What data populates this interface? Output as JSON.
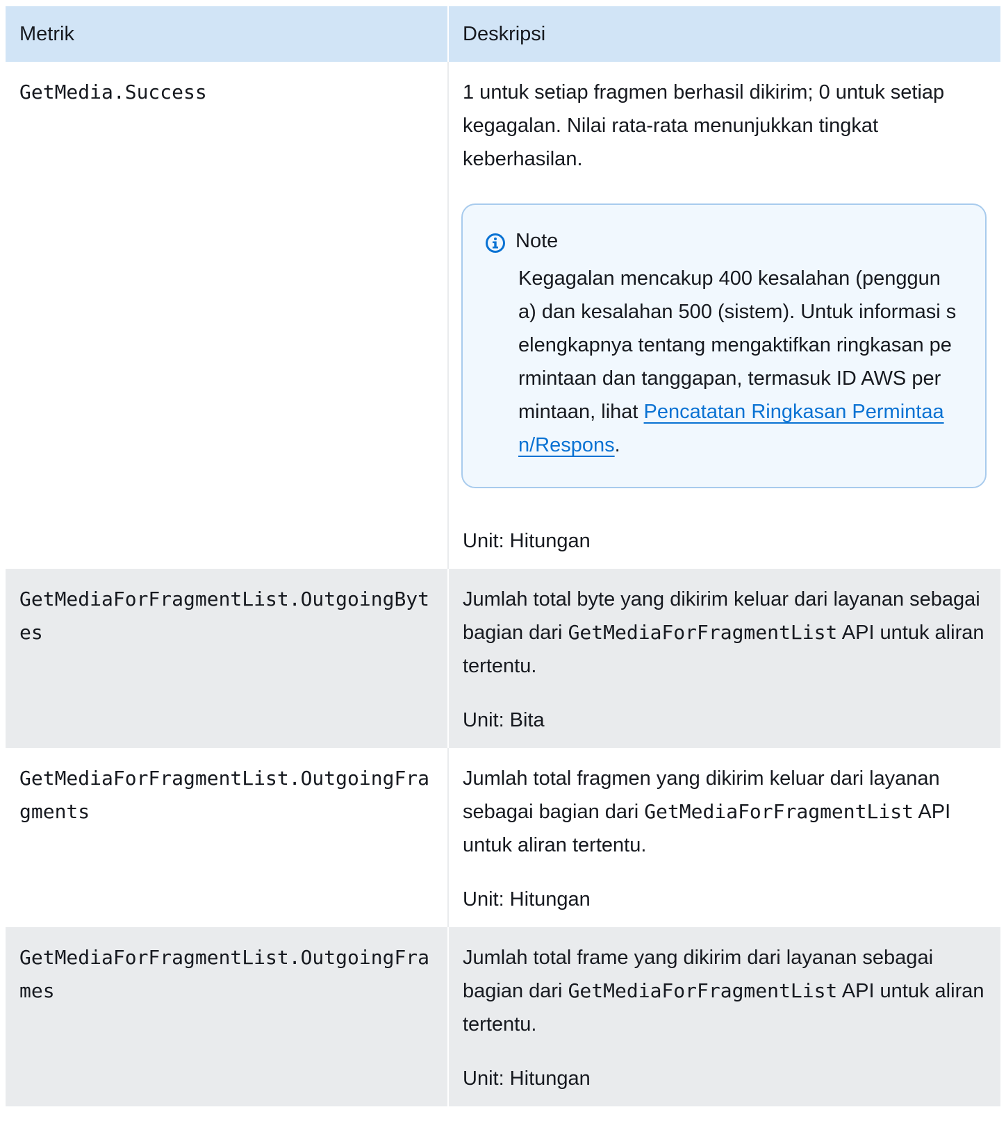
{
  "header": {
    "col_metric": "Metrik",
    "col_description": "Deskripsi"
  },
  "rows": [
    {
      "metric": "GetMedia.Success",
      "description": "1 untuk setiap fragmen berhasil dikirim; 0 untuk setiap kegagalan. Nilai rata-rata menunjukkan tingkat keberhasilan.",
      "note": {
        "title": "Note",
        "text": "Kegagalan mencakup 400 kesalahan (pengguna) dan kesalahan 500 (sistem). Untuk informasi selengkapnya tentang mengaktifkan ringkasan permintaan dan tanggapan, termasuk ID AWS permintaan, lihat ",
        "link_text": "Pencatatan Ringkasan Permintaan/Respons",
        "after_link": "."
      },
      "unit": "Unit: Hitungan"
    },
    {
      "metric": "GetMediaForFragmentList.OutgoingBytes",
      "description_before": "Jumlah total byte yang dikirim keluar dari layanan sebagai bagian dari ",
      "description_code": "GetMediaForFragmentList",
      "description_after": " API untuk aliran tertentu.",
      "unit": "Unit: Bita"
    },
    {
      "metric": "GetMediaForFragmentList.OutgoingFragments",
      "description_before": "Jumlah total fragmen yang dikirim keluar dari layanan sebagai bagian dari ",
      "description_code": "GetMediaForFragmentList",
      "description_after": " API untuk aliran tertentu.",
      "unit": "Unit: Hitungan"
    },
    {
      "metric": "GetMediaForFragmentList.OutgoingFrames",
      "description_before": "Jumlah total frame yang dikirim dari layanan sebagai bagian dari ",
      "description_code": "GetMediaForFragmentList",
      "description_after": " API untuk aliran tertentu.",
      "unit": "Unit: Hitungan"
    }
  ],
  "colors": {
    "header_bg": "#d1e4f6",
    "shaded_row_bg": "#e9ebed",
    "note_bg": "#f1f8fe",
    "note_border": "#a8cbed",
    "link": "#0972d3"
  },
  "icons": {
    "note_icon": "info-circle-icon"
  }
}
